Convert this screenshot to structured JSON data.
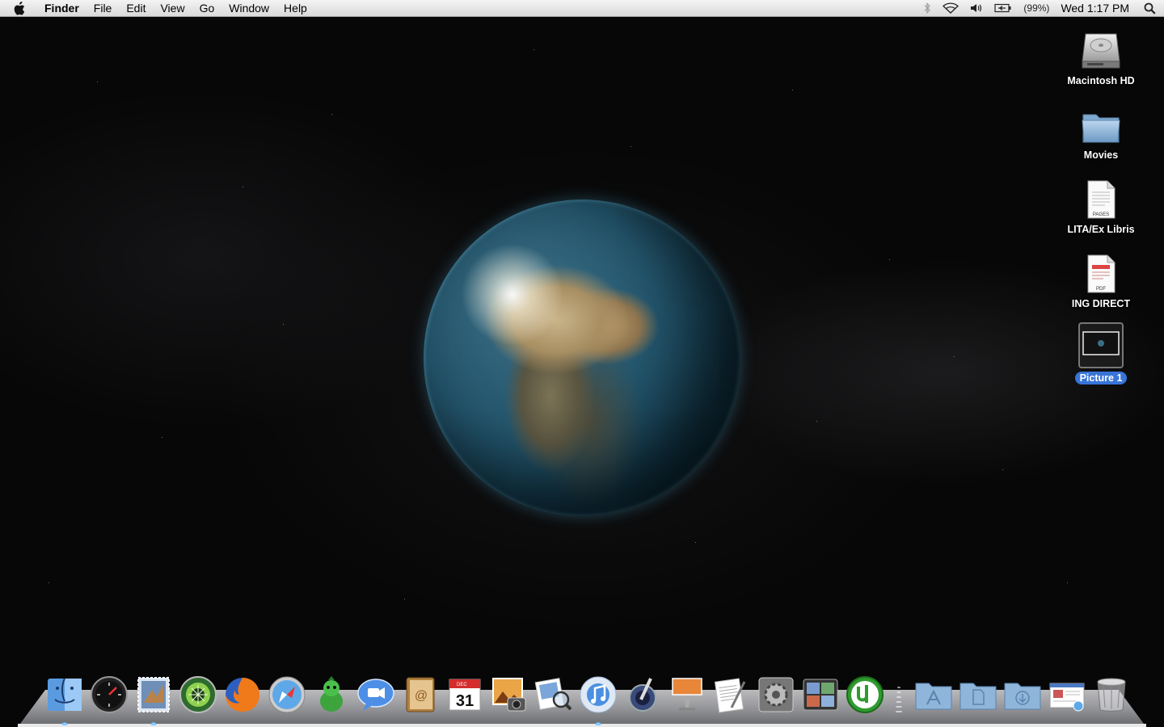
{
  "menubar": {
    "apple_icon": "apple-logo-icon",
    "app_name": "Finder",
    "menus": [
      "File",
      "Edit",
      "View",
      "Go",
      "Window",
      "Help"
    ],
    "status": {
      "battery_percent": "(99%)",
      "clock": "Wed 1:17 PM"
    }
  },
  "desktop_icons": [
    {
      "label": "Macintosh HD",
      "icon": "hard-drive-icon"
    },
    {
      "label": "Movies",
      "icon": "folder-icon"
    },
    {
      "label": "LITA/Ex Libris",
      "icon": "pages-document-icon",
      "badge": "PAGES"
    },
    {
      "label": "ING DIRECT",
      "icon": "pdf-document-icon",
      "badge": "PDF"
    },
    {
      "label": "Picture 1",
      "icon": "image-thumbnail-icon",
      "selected": true
    }
  ],
  "dock": {
    "apps": [
      {
        "name": "finder",
        "running": true
      },
      {
        "name": "dashboard",
        "running": false
      },
      {
        "name": "mail",
        "running": true
      },
      {
        "name": "camino",
        "running": false
      },
      {
        "name": "firefox",
        "running": false
      },
      {
        "name": "safari",
        "running": false
      },
      {
        "name": "adium",
        "running": false
      },
      {
        "name": "ichat",
        "running": false
      },
      {
        "name": "address-book",
        "running": false
      },
      {
        "name": "ical",
        "running": false,
        "calendar_month": "DEC",
        "calendar_day": "31"
      },
      {
        "name": "iphoto",
        "running": false
      },
      {
        "name": "preview",
        "running": false
      },
      {
        "name": "itunes",
        "running": true
      },
      {
        "name": "aperture",
        "running": false
      },
      {
        "name": "keynote",
        "running": false
      },
      {
        "name": "textedit",
        "running": false
      },
      {
        "name": "system-preferences",
        "running": false
      },
      {
        "name": "spaces",
        "running": false
      },
      {
        "name": "utorrent",
        "running": false
      }
    ],
    "stacks": [
      {
        "name": "applications-folder"
      },
      {
        "name": "documents-folder"
      },
      {
        "name": "downloads-folder"
      },
      {
        "name": "web-receipt-stack"
      },
      {
        "name": "trash"
      }
    ]
  }
}
